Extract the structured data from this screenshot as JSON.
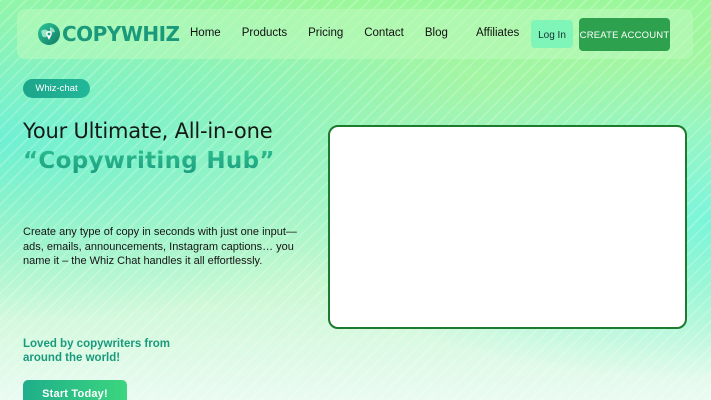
{
  "brand": {
    "name": "COPYWHIZ",
    "logo_icon": "globe-pin-icon",
    "color": "#1a9a7a"
  },
  "nav": {
    "links": [
      {
        "label": "Home"
      },
      {
        "label": "Products"
      },
      {
        "label": "Pricing"
      },
      {
        "label": "Contact"
      },
      {
        "label": "Blog"
      }
    ],
    "affiliates": "Affiliates",
    "login": "Log In",
    "create_account": "CREATE ACCOUNT"
  },
  "hero": {
    "badge": "Whiz-chat",
    "headline_prefix": "Your Ultimate, All-in-one ",
    "headline_highlight": "“Copywriting Hub”",
    "description": "Create any type of copy in seconds with just one input—ads, emails, announcements, Instagram captions… you name it – the Whiz Chat handles it all effortlessly.",
    "loved": "Loved by copywriters from around the world!",
    "cta": "Start Today!"
  },
  "colors": {
    "accent": "#1a9a7a",
    "cta_green": "#2ea14e",
    "login_bg": "#7ff5b7",
    "preview_border": "#1e7a2e"
  }
}
